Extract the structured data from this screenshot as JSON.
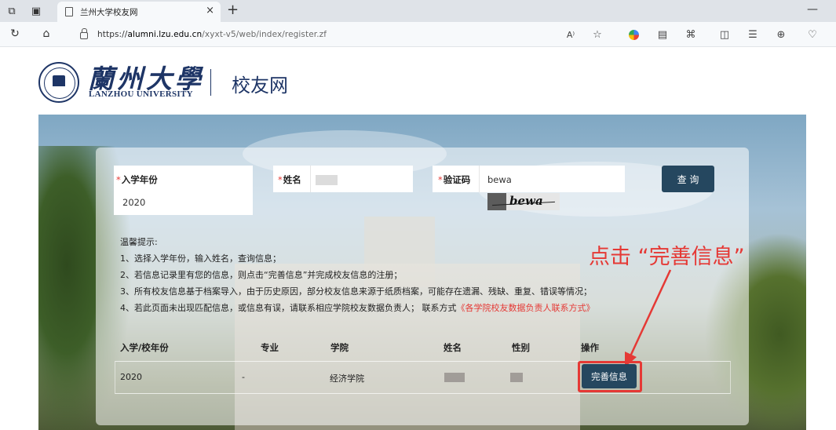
{
  "browser": {
    "tab_title": "兰州大学校友网",
    "tab_close": "×",
    "new_tab": "+",
    "minimize": "—",
    "url_scheme": "https://",
    "url_host": "alumni.lzu.edu.cn",
    "url_path": "/xyxt-v5/web/index/register.zf",
    "read_aloud": "A⁾"
  },
  "header": {
    "university_cn": "蘭州大學",
    "university_en": "LANZHOU UNIVERSITY",
    "site_name": "校友网"
  },
  "form": {
    "year_label": "入学年份",
    "year_value": "2020",
    "name_label": "姓名",
    "captcha_label": "验证码",
    "captcha_value": "bewa",
    "captcha_image_text": "bewa",
    "required_mark": "*",
    "query_button": "查 询"
  },
  "tips": {
    "heading": "温馨提示:",
    "line1": "1、选择入学年份，输入姓名，查询信息；",
    "line2": "2、若信息记录里有您的信息，则点击“完善信息”并完成校友信息的注册；",
    "line3": "3、所有校友信息基于档案导入，由于历史原因，部分校友信息来源于纸质档案，可能存在遗漏、残缺、重复、错误等情况；",
    "line4": "4、若此页面未出现匹配信息，或信息有误，请联系相应学院校友数据负责人；  联系方式",
    "line4_link": "《各学院校友数据负责人联系方式》"
  },
  "annotation": "点击 “完善信息”",
  "table": {
    "headers": [
      "入学/校年份",
      "专业",
      "学院",
      "姓名",
      "性别",
      "操作"
    ],
    "row": {
      "year": "2020",
      "major": "-",
      "college": "经济学院",
      "action": "完善信息"
    }
  },
  "colors": {
    "brand": "#1e3566",
    "button": "#25475f",
    "highlight": "#e53935"
  }
}
